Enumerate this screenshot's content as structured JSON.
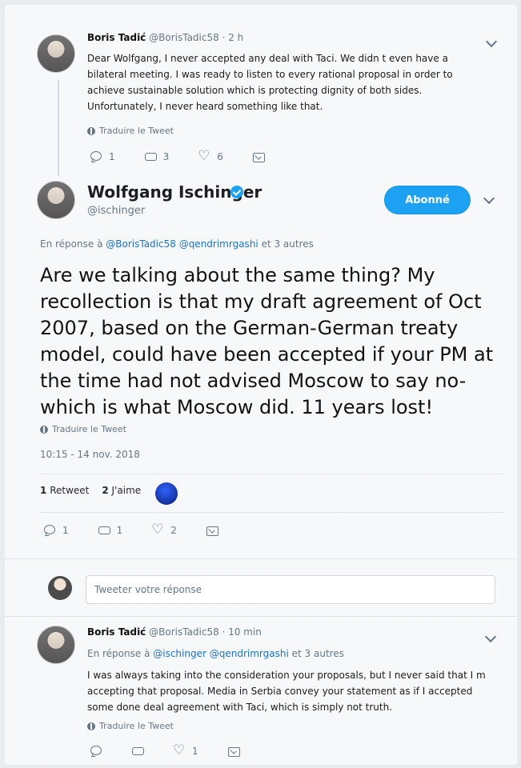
{
  "thread_top": {
    "author_name": "Boris Tadić",
    "author_handle": "@BorisTadic58",
    "time": "· 2 h",
    "text": "Dear Wolfgang, I never accepted any deal with Taci. We didn t even have a bilateral meeting. I was ready to listen to every rational proposal in order to achieve sustainable solution which is protecting dignity of both sides. Unfortunately, I never heard something like that.",
    "translate_label": "Traduire le Tweet",
    "actions": {
      "reply_count": "1",
      "retweet_count": "3",
      "like_count": "6"
    },
    "icon_names": [
      "reply-icon",
      "retweet-icon",
      "heart-icon",
      "dm-icon"
    ]
  },
  "main_tweet": {
    "author_name": "Wolfgang Ischinger",
    "author_handle": "@ischinger",
    "follow_label": "Abonné",
    "reply_context": {
      "prefix": "En réponse à ",
      "mention_1": "@BorisTadic58",
      "mention_2": "@qendrimrgashi",
      "suffix": " et 3 autres"
    },
    "text": "Are we talking about the same thing? My recollection is that my draft agreement of Oct 2007, based on the German-German treaty model, could have been accepted if your PM at the time had not advised Moscow to say no- which is what Moscow did. 11 years lost!",
    "translate_label": "Traduire le Tweet",
    "datetime": "10:15 - 14 nov. 2018",
    "stats": {
      "retweets_count": "1",
      "retweets_label": "Retweet",
      "likes_count": "2",
      "likes_label": "J'aime"
    },
    "actions": {
      "reply_count": "1",
      "retweet_count": "1",
      "like_count": "2"
    }
  },
  "reply_composer": {
    "placeholder": "Tweeter votre réponse"
  },
  "thread_bottom": {
    "author_name": "Boris Tadić",
    "author_handle": "@BorisTadic58",
    "time": "· 10 min",
    "reply_context": {
      "prefix": "En réponse à ",
      "mention_1": "@ischinger",
      "mention_2": "@qendrimrgashi",
      "suffix": " et 3 autres"
    },
    "text": "I was always taking into the consideration your proposals, but I never said that I m accepting that proposal. Media in Serbia convey your statement as if I accepted some done deal agreement with Taci, which is simply not truth.",
    "translate_label": "Traduire le Tweet",
    "actions": {
      "like_count": "1"
    }
  },
  "colors": {
    "accent": "#1da1f2",
    "link": "#1d72c7",
    "muted": "#657786"
  }
}
